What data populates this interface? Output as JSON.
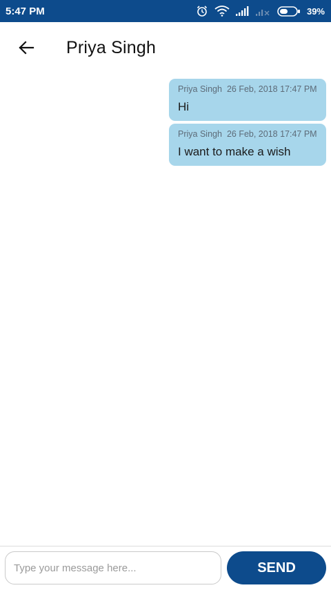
{
  "status_bar": {
    "time": "5:47 PM",
    "battery_percent": "39%",
    "icons": [
      "alarm-icon",
      "wifi-icon",
      "signal-icon",
      "signal-no-sim-icon",
      "battery-icon"
    ]
  },
  "header": {
    "back_icon": "arrow-left-icon",
    "title": "Priya Singh"
  },
  "messages": [
    {
      "sender": "Priya Singh",
      "timestamp": "26 Feb, 2018 17:47 PM",
      "text": "Hi"
    },
    {
      "sender": "Priya Singh",
      "timestamp": "26 Feb, 2018 17:47 PM",
      "text": "I want to make a wish"
    }
  ],
  "compose": {
    "placeholder": "Type your message here...",
    "value": "",
    "send_label": "SEND"
  },
  "colors": {
    "primary": "#0d4b8c",
    "bubble": "#a7d6eb"
  }
}
